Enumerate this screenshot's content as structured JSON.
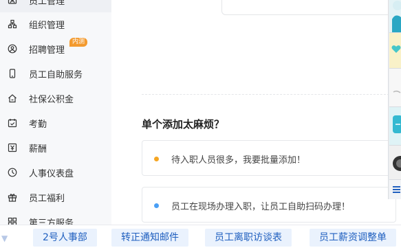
{
  "sidebar": {
    "items": [
      {
        "label": "员工管理",
        "icon": "employee-icon"
      },
      {
        "label": "组织管理",
        "icon": "org-icon"
      },
      {
        "label": "招聘管理",
        "icon": "recruit-icon",
        "badge": "内测"
      },
      {
        "label": "员工自助服务",
        "icon": "phone-icon"
      },
      {
        "label": "社保公积金",
        "icon": "house-icon"
      },
      {
        "label": "考勤",
        "icon": "calendar-icon"
      },
      {
        "label": "薪酬",
        "icon": "salary-icon"
      },
      {
        "label": "人事仪表盘",
        "icon": "dashboard-icon"
      },
      {
        "label": "员工福利",
        "icon": "gift-icon"
      },
      {
        "label": "第三方服务",
        "icon": "apps-icon"
      }
    ]
  },
  "main": {
    "section_title": "单个添加太麻烦？",
    "tips": [
      {
        "text": "待入职人员很多，我要批量添加！",
        "dot_color": "#f5a623"
      },
      {
        "text": "员工在现场办理入职，让员工自助扫码办理！",
        "dot_color": "#4a9ff5"
      }
    ]
  },
  "bottom_links": [
    "2号人事部",
    "转正通知邮件",
    "员工离职访谈表",
    "员工薪资调整单"
  ],
  "colors": {
    "accent": "#1f5fbf",
    "badge": "#f39a2e",
    "link_bg": "#eaf2fd"
  }
}
